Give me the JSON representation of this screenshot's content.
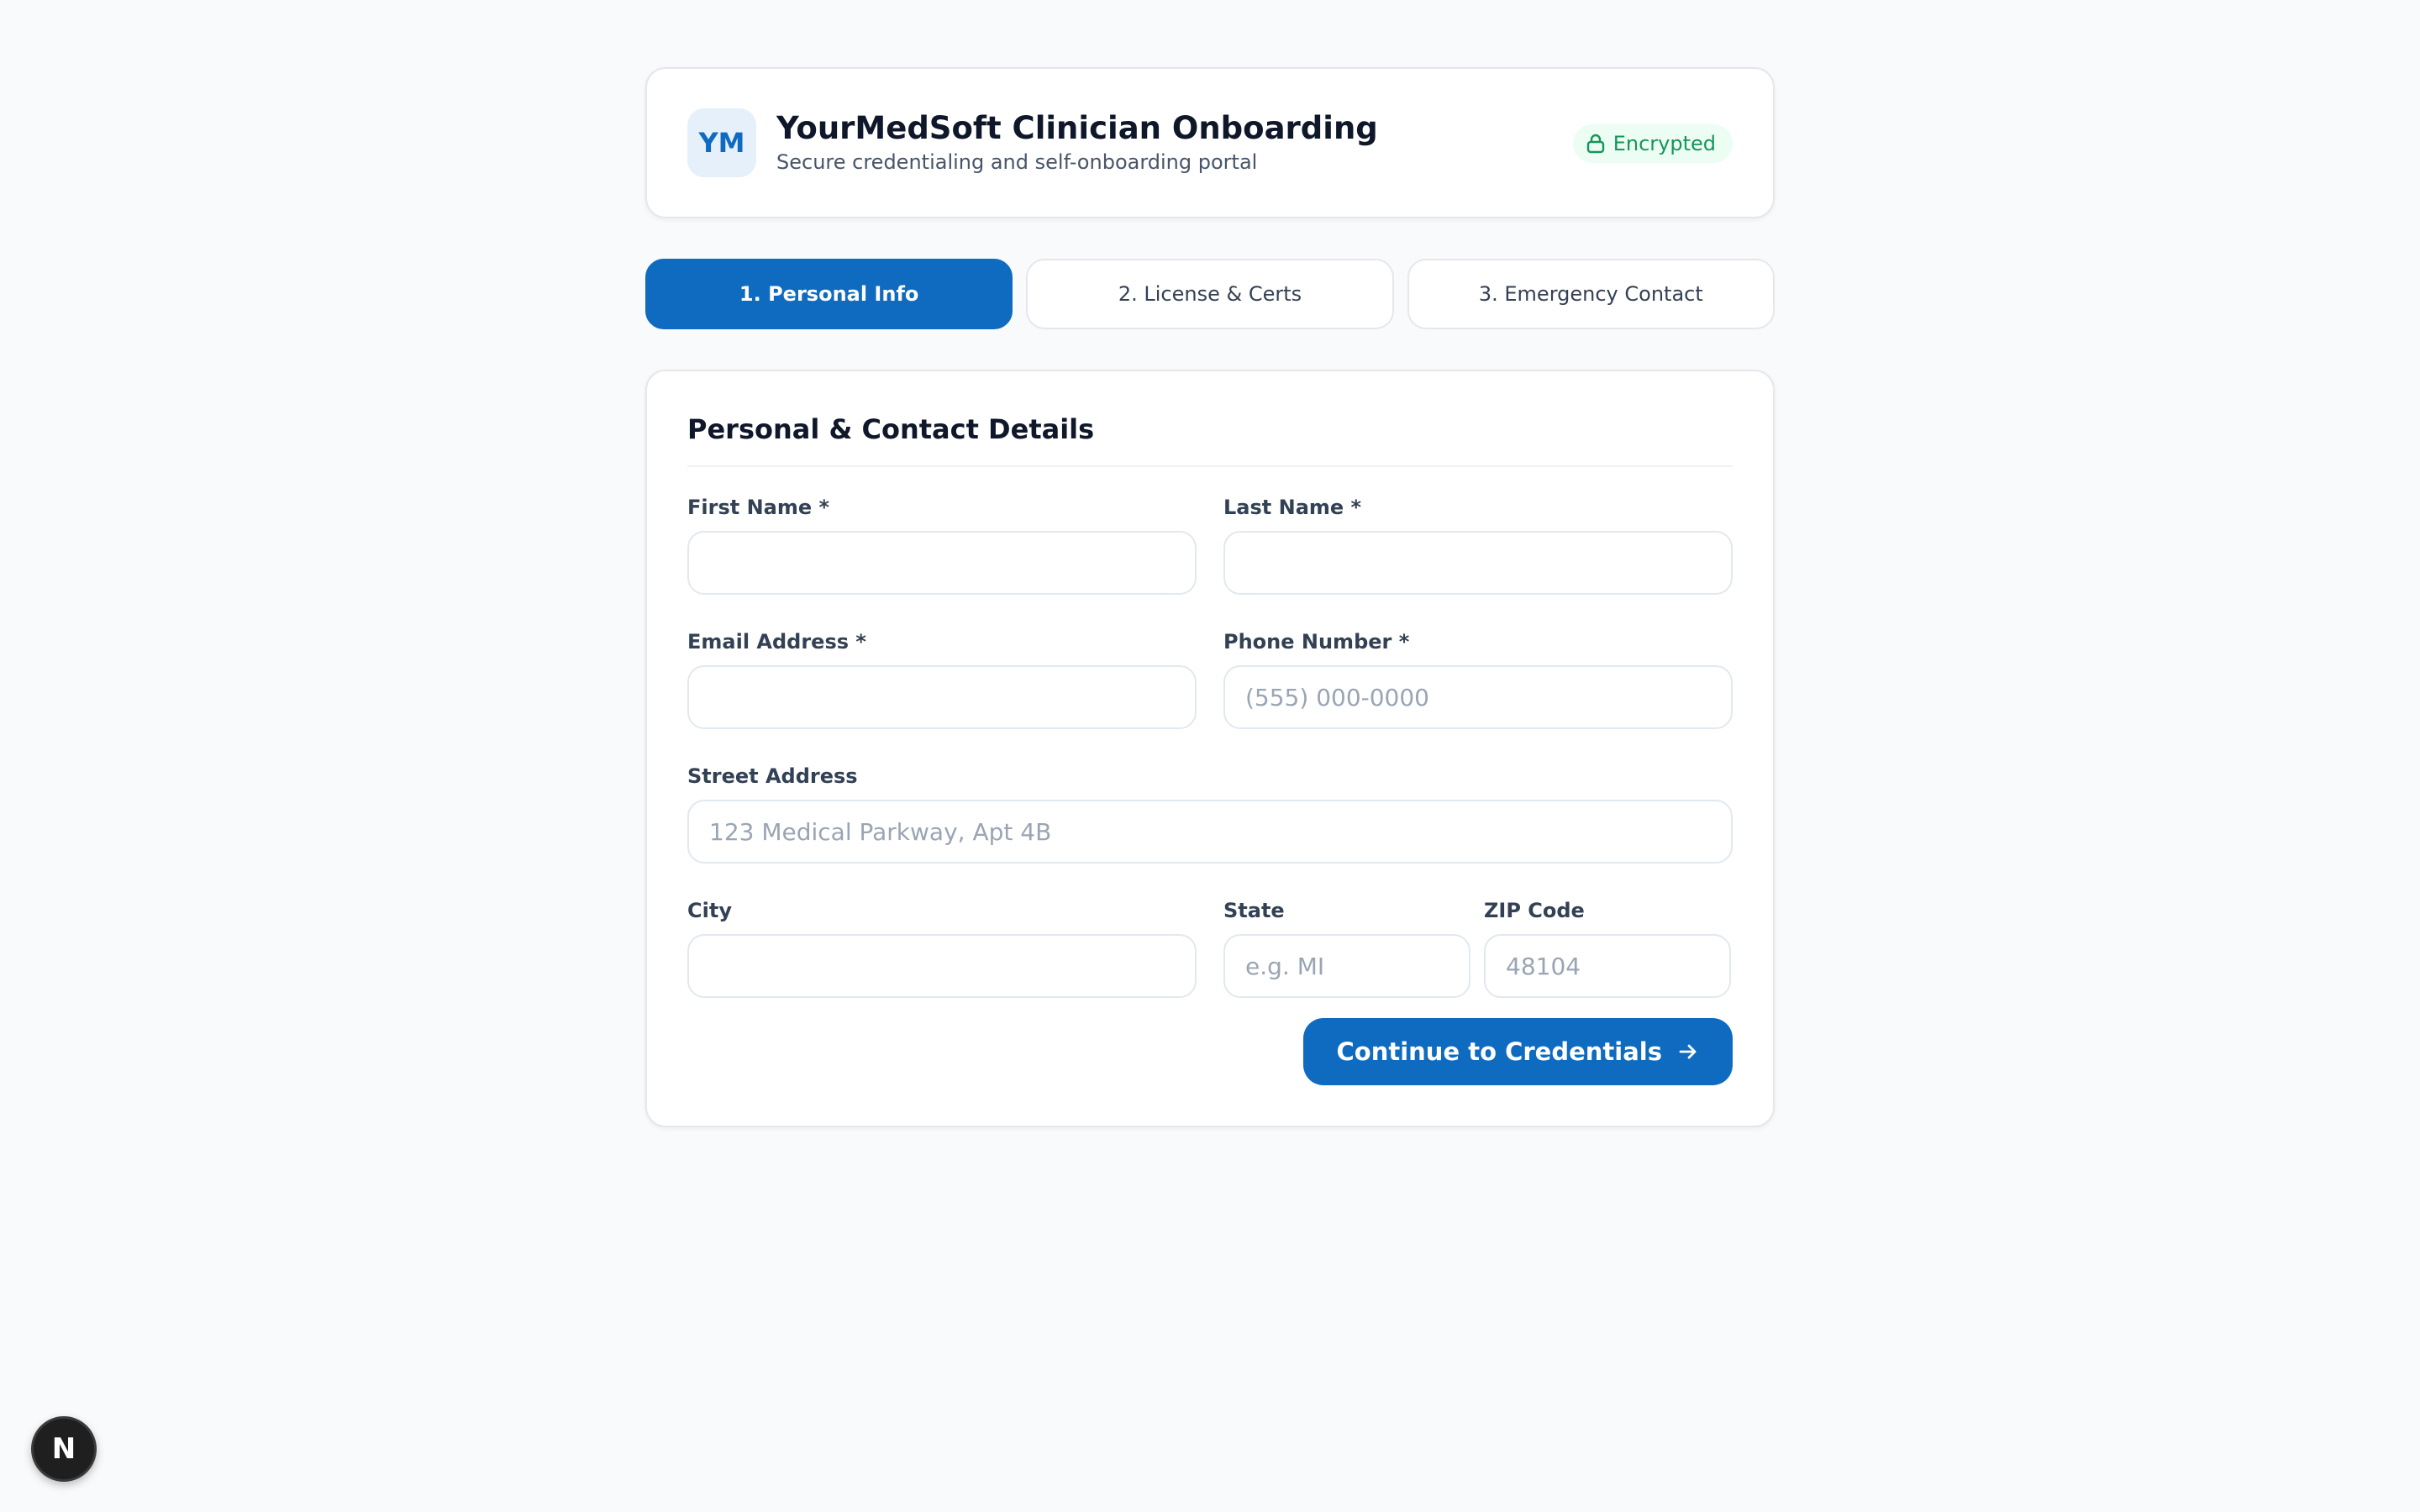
{
  "header": {
    "logo_text": "YM",
    "title": "YourMedSoft Clinician Onboarding",
    "subtitle": "Secure credentialing and self-onboarding portal",
    "badge_label": "Encrypted",
    "badge_icon": "lock-icon"
  },
  "steps": [
    {
      "label": "1. Personal Info",
      "active": true
    },
    {
      "label": "2. License & Certs",
      "active": false
    },
    {
      "label": "3. Emergency Contact",
      "active": false
    }
  ],
  "form": {
    "section_title": "Personal & Contact Details",
    "first_name": {
      "label": "First Name *",
      "value": "",
      "placeholder": ""
    },
    "last_name": {
      "label": "Last Name *",
      "value": "",
      "placeholder": ""
    },
    "email": {
      "label": "Email Address *",
      "value": "",
      "placeholder": ""
    },
    "phone": {
      "label": "Phone Number *",
      "value": "",
      "placeholder": "(555) 000-0000"
    },
    "street": {
      "label": "Street Address",
      "value": "",
      "placeholder": "123 Medical Parkway, Apt 4B"
    },
    "city": {
      "label": "City",
      "value": "",
      "placeholder": ""
    },
    "state": {
      "label": "State",
      "value": "",
      "placeholder": "e.g. MI"
    },
    "zip": {
      "label": "ZIP Code",
      "value": "",
      "placeholder": "48104"
    },
    "continue_label": "Continue to Credentials",
    "continue_icon": "arrow-right-icon"
  },
  "floating_badge": {
    "label": "N"
  },
  "colors": {
    "primary": "#0e6bbf",
    "background": "#f8fafc",
    "success": "#16955a",
    "success_bg": "#ecfdf3"
  }
}
